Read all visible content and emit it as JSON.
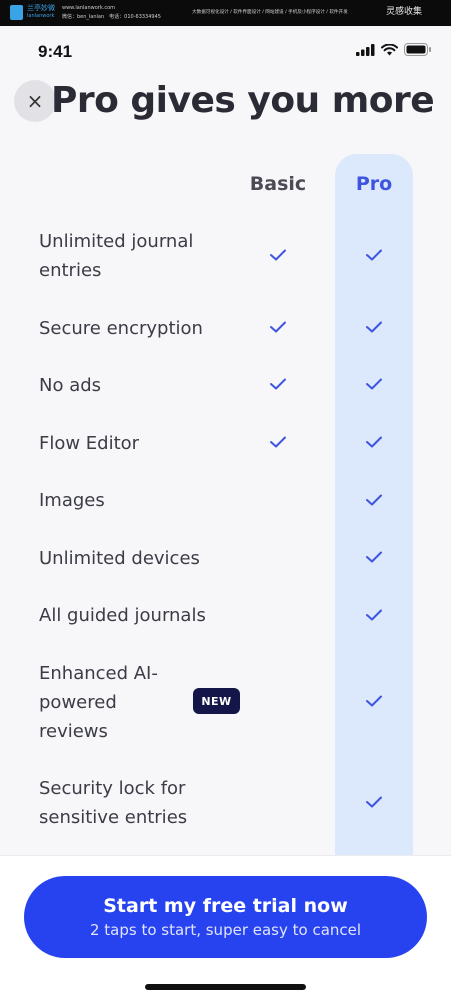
{
  "banner": {
    "logo_text": "兰亭妙微",
    "logo_sub": "lanlanwork",
    "url": "www.lanlanwork.com",
    "contact": "微信：ben_lanlan　电话：010-63334945",
    "services": "大数据可视化设计 / 软件界面设计 / 网站建设 / 手机及小程序设计 / 软件开发",
    "brand": "灵感收集"
  },
  "status_bar": {
    "time": "9:41",
    "icons": [
      "signal-icon",
      "wifi-icon",
      "battery-icon"
    ]
  },
  "header": {
    "close_icon": "close-icon",
    "close_glyph": "×",
    "title": "Pro gives you more"
  },
  "columns": {
    "basic": "Basic",
    "pro": "Pro"
  },
  "features": [
    {
      "label": "Unlimited journal entries",
      "basic": true,
      "pro": true
    },
    {
      "label": "Secure encryption",
      "basic": true,
      "pro": true
    },
    {
      "label": "No ads",
      "basic": true,
      "pro": true
    },
    {
      "label": "Flow Editor",
      "basic": true,
      "pro": true
    },
    {
      "label": "Images",
      "basic": false,
      "pro": true
    },
    {
      "label": "Unlimited devices",
      "basic": false,
      "pro": true
    },
    {
      "label": "All guided journals",
      "basic": false,
      "pro": true
    },
    {
      "label": "Enhanced AI-powered reviews",
      "basic": false,
      "pro": true,
      "badge": "NEW"
    },
    {
      "label": "Security lock for sensitive entries",
      "basic": false,
      "pro": true
    }
  ],
  "cta": {
    "title": "Start my free trial now",
    "subtitle": "2 taps to start, super easy to cancel"
  },
  "colors": {
    "accent": "#2743f0",
    "check": "#3d55e0",
    "pro_column": "#dce8fb",
    "badge": "#14164a"
  }
}
